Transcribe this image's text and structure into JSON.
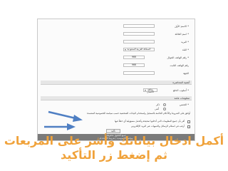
{
  "form": {
    "field_first_label": "الاسم الأول *",
    "field_family_label": "اسم العائلة *",
    "field_email_label": "البريد *",
    "field_country_label": "البلد *",
    "field_country_value": "المملكة العربية السعودية",
    "field_phone_label": "رقم الهاتف الجوال *",
    "field_phone_value": "966",
    "field_phone2_label": "رقم الهاتف الثابت",
    "field_phone2_value": "966",
    "field_org_label": "الجهة",
    "section2_header": "أهمية المحاضرة",
    "section2_label": "أسلوب الدفع *",
    "section2_value": "بطاقة الائتمان",
    "section3_header": "معلومات عامة",
    "section3_label": "الجنس *",
    "option_male": "ذكر",
    "option_female": "أنثى",
    "agree_text": "أوافق على الشروط والأحكام الخاصة بالتسجيل واستخدام البيانات الشخصية حسب سياسة الخصوصية المعتمدة",
    "check1_text": "أقر بأن جميع المعلومات التي أدخلتها صحيحة وأتحمل مسؤولية أي خطأ فيها",
    "check2_text": "أرغب في استلام الرسائل والتنبيهات عبر البريد الإلكتروني",
    "submit_label": "تأكيد"
  },
  "footer": {
    "line1": "جميع الحقوق محفوظة",
    "line2": "سياسة الخصوصية | شروط الاستخدام"
  },
  "caption": {
    "line1": "أكمل ادخال بياناتك وأشر على المربعات",
    "line2": "ثم إضغط زر التأكيد"
  },
  "colors": {
    "caption": "#f0a23a",
    "arrow": "#4f7fc3",
    "footer_bar": "#7a7a7a"
  }
}
